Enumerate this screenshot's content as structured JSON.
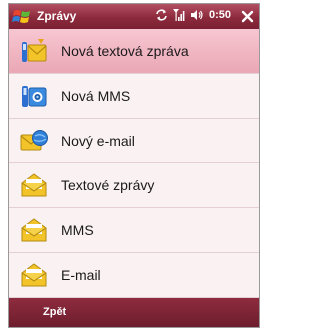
{
  "titlebar": {
    "title": "Zprávy",
    "clock": "0:50",
    "icons": [
      "windows-start-icon",
      "sync-icon",
      "signal-icon",
      "speaker-icon",
      "close-icon"
    ]
  },
  "menu": {
    "items": [
      {
        "label": "Nová textová zpráva",
        "icon": "new-sms-icon",
        "selected": true
      },
      {
        "label": "Nová MMS",
        "icon": "new-mms-icon",
        "selected": false
      },
      {
        "label": "Nový e-mail",
        "icon": "new-email-icon",
        "selected": false
      },
      {
        "label": "Textové zprávy",
        "icon": "sms-folder-icon",
        "selected": false
      },
      {
        "label": "MMS",
        "icon": "mms-folder-icon",
        "selected": false
      },
      {
        "label": "E-mail",
        "icon": "email-folder-icon",
        "selected": false
      }
    ]
  },
  "softkeys": {
    "left": "Zpět"
  },
  "colors": {
    "titlebar": "#8c2a3c",
    "selected": "#eaa7b5",
    "list_bg": "#faf1f3"
  }
}
